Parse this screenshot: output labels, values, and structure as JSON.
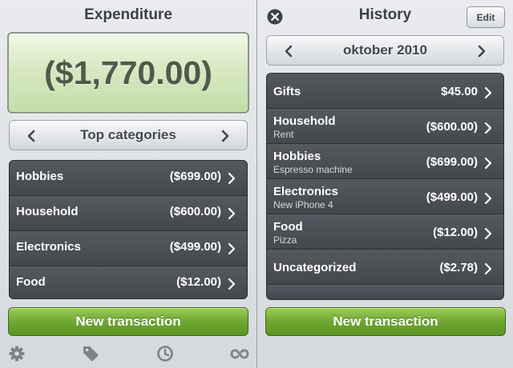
{
  "expenditure": {
    "title": "Expenditure",
    "amount": "($1,770.00)",
    "selector_label": "Top categories",
    "categories": [
      {
        "label": "Hobbies",
        "amount": "($699.00)"
      },
      {
        "label": "Household",
        "amount": "($600.00)"
      },
      {
        "label": "Electronics",
        "amount": "($499.00)"
      },
      {
        "label": "Food",
        "amount": "($12.00)"
      }
    ],
    "new_transaction_label": "New transaction",
    "tabs": [
      {
        "icon": "gear-icon"
      },
      {
        "icon": "tag-icon"
      },
      {
        "icon": "clock-icon"
      },
      {
        "icon": "repeat-icon"
      }
    ]
  },
  "history": {
    "title": "History",
    "edit_label": "Edit",
    "month_label": "oktober 2010",
    "transactions": [
      {
        "label": "Gifts",
        "note": "",
        "amount": "$45.00"
      },
      {
        "label": "Household",
        "note": "Rent",
        "amount": "($600.00)"
      },
      {
        "label": "Hobbies",
        "note": "Espresso machine",
        "amount": "($699.00)"
      },
      {
        "label": "Electronics",
        "note": "New iPhone 4",
        "amount": "($499.00)"
      },
      {
        "label": "Food",
        "note": "Pizza",
        "amount": "($12.00)"
      },
      {
        "label": "Uncategorized",
        "note": "",
        "amount": "($2.78)"
      }
    ],
    "new_transaction_label": "New transaction"
  },
  "colors": {
    "accent_green": "#6fa732",
    "list_background": "#4a4d52",
    "amount_panel": "#d7e9c2"
  }
}
